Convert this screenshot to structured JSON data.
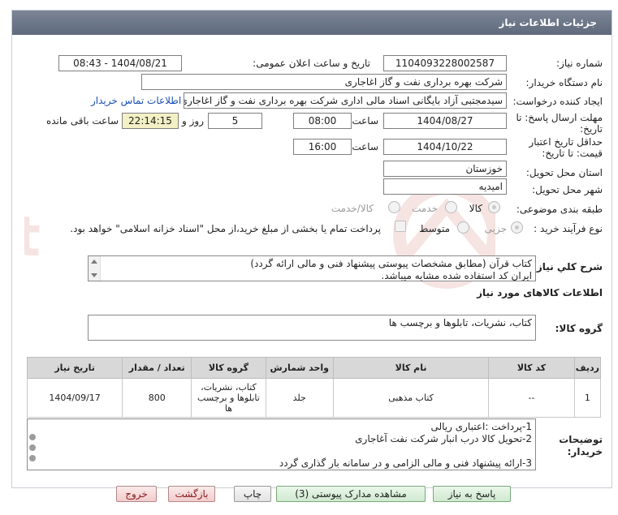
{
  "window": {
    "title": "جزئیات اطلاعات نیاز"
  },
  "form": {
    "need_number": {
      "label": "شماره نیاز:",
      "value": "1104093228002587"
    },
    "announce_datetime": {
      "label": "تاریخ و ساعت اعلان عمومی:",
      "value": "1404/08/21 - 08:43"
    },
    "buyer_org": {
      "label": "نام دستگاه خریدار:",
      "value": "شرکت بهره برداری نفت و گاز اغاجاری"
    },
    "requester": {
      "label": "ایجاد کننده درخواست:",
      "value": "سیدمجتبی آزاد بایگانی اسناد مالی اداری شرکت بهره برداری نفت و گاز اغاجاری"
    },
    "contact_link": "اطلاعات تماس خریدار",
    "deadline": {
      "label_line1": "مهلت ارسال پاسخ: تا",
      "label_line2": "تاریخ:",
      "date": "1404/08/27",
      "time_label": "ساعت",
      "time": "08:00",
      "days": "5",
      "days_label": "روز و",
      "remaining": "22:14:15",
      "remaining_label": "ساعت باقی مانده"
    },
    "price_validity": {
      "label_line1": "حداقل تاریخ اعتبار",
      "label_line2": "قیمت: تا تاریخ:",
      "date": "1404/10/22",
      "time_label": "ساعت",
      "time": "16:00"
    },
    "province": {
      "label": "استان محل تحویل:",
      "value": "خوزستان"
    },
    "city": {
      "label": "شهر محل تحویل:",
      "value": "امیدیه"
    },
    "category": {
      "label": "طبقه بندی موضوعی:",
      "options": [
        "کالا",
        "خدمت",
        "کالا/خدمت"
      ],
      "selected": "کالا"
    },
    "purchase_type": {
      "label": "نوع فرآیند خرید :",
      "options": [
        "جزیی",
        "متوسط"
      ],
      "selected": "جزیی",
      "treasury_note": "پرداخت تمام یا بخشی از مبلغ خرید،از محل \"اسناد خزانه اسلامی\" خواهد بود."
    }
  },
  "summary": {
    "label": "شرح کلي نياز:",
    "line1": "کتاب قرآن (مطابق مشخصات پیوستی پیشنهاد فنی و مالی ارائه گردد)",
    "line2": "ایران کد استفاده شده مشابه میباشد."
  },
  "goods_section": {
    "title": "اطلاعات کالاهای مورد نیاز",
    "group_label": "گروه کالا:",
    "group_value": "کتاب، نشریات، تابلوها و برچسب ها"
  },
  "table": {
    "headers": [
      "ردیف",
      "کد کالا",
      "نام کالا",
      "واحد شمارش",
      "گروه کالا",
      "تعداد / مقدار",
      "تاریخ نیاز"
    ],
    "rows": [
      [
        "1",
        "--",
        "کتاب مذهبی",
        "جلد",
        "کتاب، نشریات، تابلوها و برچسب ها",
        "800",
        "1404/09/17"
      ]
    ]
  },
  "buyer_notes": {
    "label_line1": "توضیحات",
    "label_line2": "خریدار:",
    "lines": [
      "1-پرداخت :اعتباری ریالی",
      "2-تحویل کالا درب انبار شرکت نفت آغاجاری",
      "",
      "3-ارائه پیشنهاد فنی و مالی الزامی و در سامانه بار گذاری گردد"
    ]
  },
  "buttons": {
    "reply": "پاسخ به نیاز",
    "view_docs": "مشاهده مدارک پیوستی (3)",
    "print": "چاپ",
    "back": "بازگشت",
    "exit": "خروج"
  },
  "watermark": {
    "text": "AriaTender.net"
  }
}
